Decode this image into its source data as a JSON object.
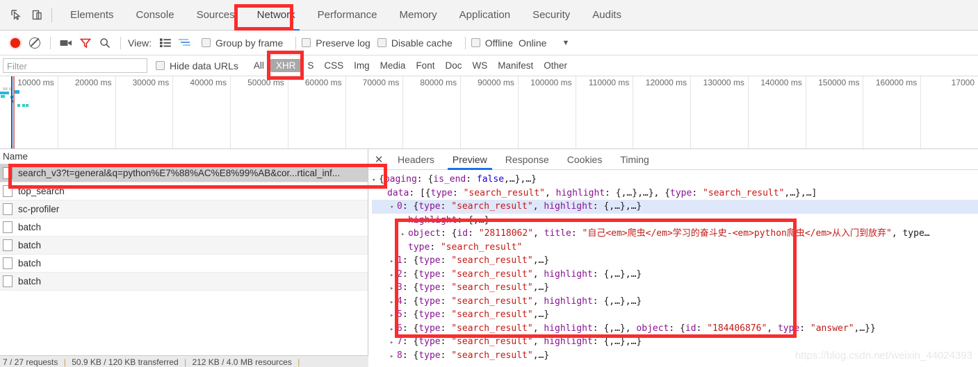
{
  "devtools": {
    "tabs": [
      {
        "label": "Elements",
        "active": false
      },
      {
        "label": "Console",
        "active": false
      },
      {
        "label": "Sources",
        "active": false
      },
      {
        "label": "Network",
        "active": true
      },
      {
        "label": "Performance",
        "active": false
      },
      {
        "label": "Memory",
        "active": false
      },
      {
        "label": "Application",
        "active": false
      },
      {
        "label": "Security",
        "active": false
      },
      {
        "label": "Audits",
        "active": false
      }
    ],
    "icons": {
      "inspect": "inspect-element-icon",
      "device": "toggle-device-toolbar-icon"
    }
  },
  "toolbar": {
    "record_icon": "record-icon",
    "clear_icon": "clear-icon",
    "camera_icon": "screenshot-camera-icon",
    "filter_icon": "filter-funnel-icon",
    "search_icon": "search-icon",
    "view_label": "View:",
    "view_list_icon": "list-view-icon",
    "view_waterfall_icon": "waterfall-view-icon",
    "group_by_frame": "Group by frame",
    "preserve_log": "Preserve log",
    "disable_cache": "Disable cache",
    "offline": "Offline",
    "throttle_value": "Online",
    "caret_icon": "chevron-down-icon"
  },
  "filterbar": {
    "placeholder": "Filter",
    "hide_data_urls": "Hide data URLs",
    "types": [
      {
        "label": "All",
        "selected": false
      },
      {
        "label": "XHR",
        "selected": true
      },
      {
        "label": "S",
        "selected": false
      },
      {
        "label": "CSS",
        "selected": false
      },
      {
        "label": "Img",
        "selected": false
      },
      {
        "label": "Media",
        "selected": false
      },
      {
        "label": "Font",
        "selected": false
      },
      {
        "label": "Doc",
        "selected": false
      },
      {
        "label": "WS",
        "selected": false
      },
      {
        "label": "Manifest",
        "selected": false
      },
      {
        "label": "Other",
        "selected": false
      }
    ]
  },
  "overview": {
    "ticks": [
      "10000 ms",
      "20000 ms",
      "30000 ms",
      "40000 ms",
      "50000 ms",
      "60000 ms",
      "70000 ms",
      "80000 ms",
      "90000 ms",
      "100000 ms",
      "110000 ms",
      "120000 ms",
      "130000 ms",
      "140000 ms",
      "150000 ms",
      "160000 ms",
      "17000"
    ]
  },
  "requests": {
    "column_header": "Name",
    "rows": [
      {
        "name": "search_v3?t=general&q=python%E7%88%AC%E8%99%AB&cor...rtical_inf...",
        "selected": true
      },
      {
        "name": "top_search",
        "selected": false
      },
      {
        "name": "sc-profiler",
        "selected": false
      },
      {
        "name": "batch",
        "selected": false
      },
      {
        "name": "batch",
        "selected": false
      },
      {
        "name": "batch",
        "selected": false
      },
      {
        "name": "batch",
        "selected": false
      }
    ],
    "status": {
      "requests": "7 / 27 requests",
      "transferred": "50.9 KB / 120 KB transferred",
      "resources": "212 KB / 4.0 MB resources"
    }
  },
  "detail": {
    "close_icon": "close-icon",
    "tabs": [
      {
        "label": "Headers",
        "active": false
      },
      {
        "label": "Preview",
        "active": true
      },
      {
        "label": "Response",
        "active": false
      },
      {
        "label": "Cookies",
        "active": false
      },
      {
        "label": "Timing",
        "active": false
      }
    ],
    "preview_lines": [
      {
        "indent": 0,
        "arrow": "down",
        "text": "{paging: {is_end: false,…},…}"
      },
      {
        "indent": 1,
        "arrow": "none",
        "text": "data: [{type: \"search_result\", highlight: {,…},…}, {type: \"search_result\",…},…]"
      },
      {
        "indent": 2,
        "arrow": "down",
        "text": "0: {type: \"search_result\", highlight: {,…},…}",
        "highlight": true
      },
      {
        "indent": 3,
        "arrow": "right",
        "text": "highlight: {,…}"
      },
      {
        "indent": 3,
        "arrow": "right",
        "text": "object: {id: \"28118062\", title: \"自己<em>爬虫</em>学习的奋斗史-<em>python爬虫</em>从入门到放弃\", type…"
      },
      {
        "indent": 3,
        "arrow": "none",
        "text": "type: \"search_result\""
      },
      {
        "indent": 2,
        "arrow": "right",
        "text": "1: {type: \"search_result\",…}"
      },
      {
        "indent": 2,
        "arrow": "right",
        "text": "2: {type: \"search_result\", highlight: {,…},…}"
      },
      {
        "indent": 2,
        "arrow": "right",
        "text": "3: {type: \"search_result\",…}"
      },
      {
        "indent": 2,
        "arrow": "right",
        "text": "4: {type: \"search_result\", highlight: {,…},…}"
      },
      {
        "indent": 2,
        "arrow": "right",
        "text": "5: {type: \"search_result\",…}"
      },
      {
        "indent": 2,
        "arrow": "right",
        "text": "6: {type: \"search_result\", highlight: {,…}, object: {id: \"184406876\", type: \"answer\",…}}"
      },
      {
        "indent": 2,
        "arrow": "right",
        "text": "7: {type: \"search_result\", highlight: {,…},…}"
      },
      {
        "indent": 2,
        "arrow": "right",
        "text": "8: {type: \"search_result\",…}"
      }
    ]
  },
  "watermark": "https://blog.csdn.net/weixin_44024393",
  "annotations": {
    "color": "#fb2c2c",
    "boxes": [
      "network-tab",
      "xhr-filter",
      "selected-request-row",
      "preview-json-block"
    ]
  }
}
